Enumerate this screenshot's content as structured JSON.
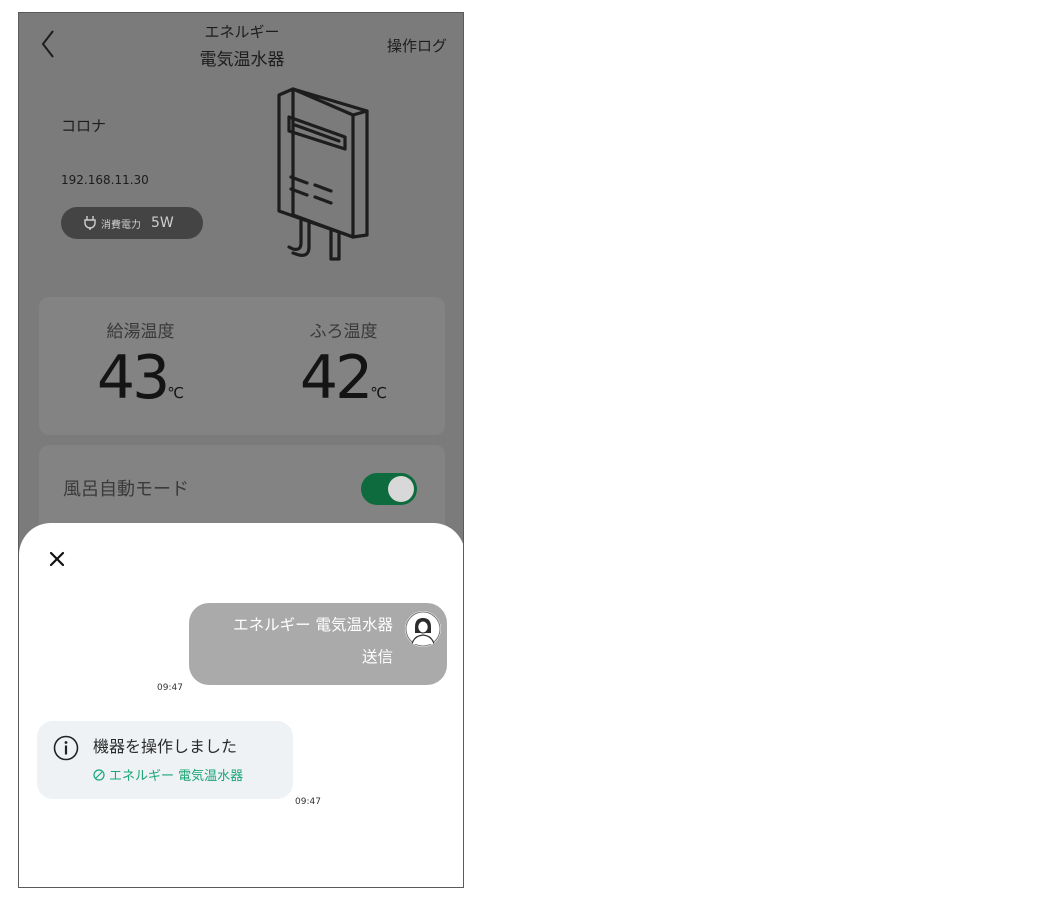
{
  "header": {
    "category": "エネルギー",
    "device_name": "電気温水器",
    "log_button": "操作ログ"
  },
  "device": {
    "maker": "コロナ",
    "ip": "192.168.11.30",
    "power_label": "消費電力",
    "power_value": "5W"
  },
  "temperatures": {
    "hot_water_label": "給湯温度",
    "hot_water_value": "43",
    "bath_label": "ふろ温度",
    "bath_value": "42",
    "unit": "℃"
  },
  "mode": {
    "label": "風呂自動モード",
    "enabled": true
  },
  "log_sheet": {
    "sent_message": {
      "line1": "エネルギー 電気温水器",
      "line2": "送信",
      "time": "09:47"
    },
    "info_message": {
      "text": "機器を操作しました",
      "device_link": "エネルギー 電気温水器",
      "time": "09:47"
    }
  },
  "icons": {
    "back": "chevron-left-icon",
    "plug": "plug-icon",
    "heater": "water-heater-icon",
    "close": "close-icon",
    "avatar": "avatar-icon",
    "info": "info-icon",
    "check": "check-circle-icon"
  },
  "colors": {
    "toggle_on": "#0d6b3e",
    "link_green": "#1aa574",
    "sent_bubble": "#aaaaaa",
    "info_bubble": "#eef2f5"
  }
}
